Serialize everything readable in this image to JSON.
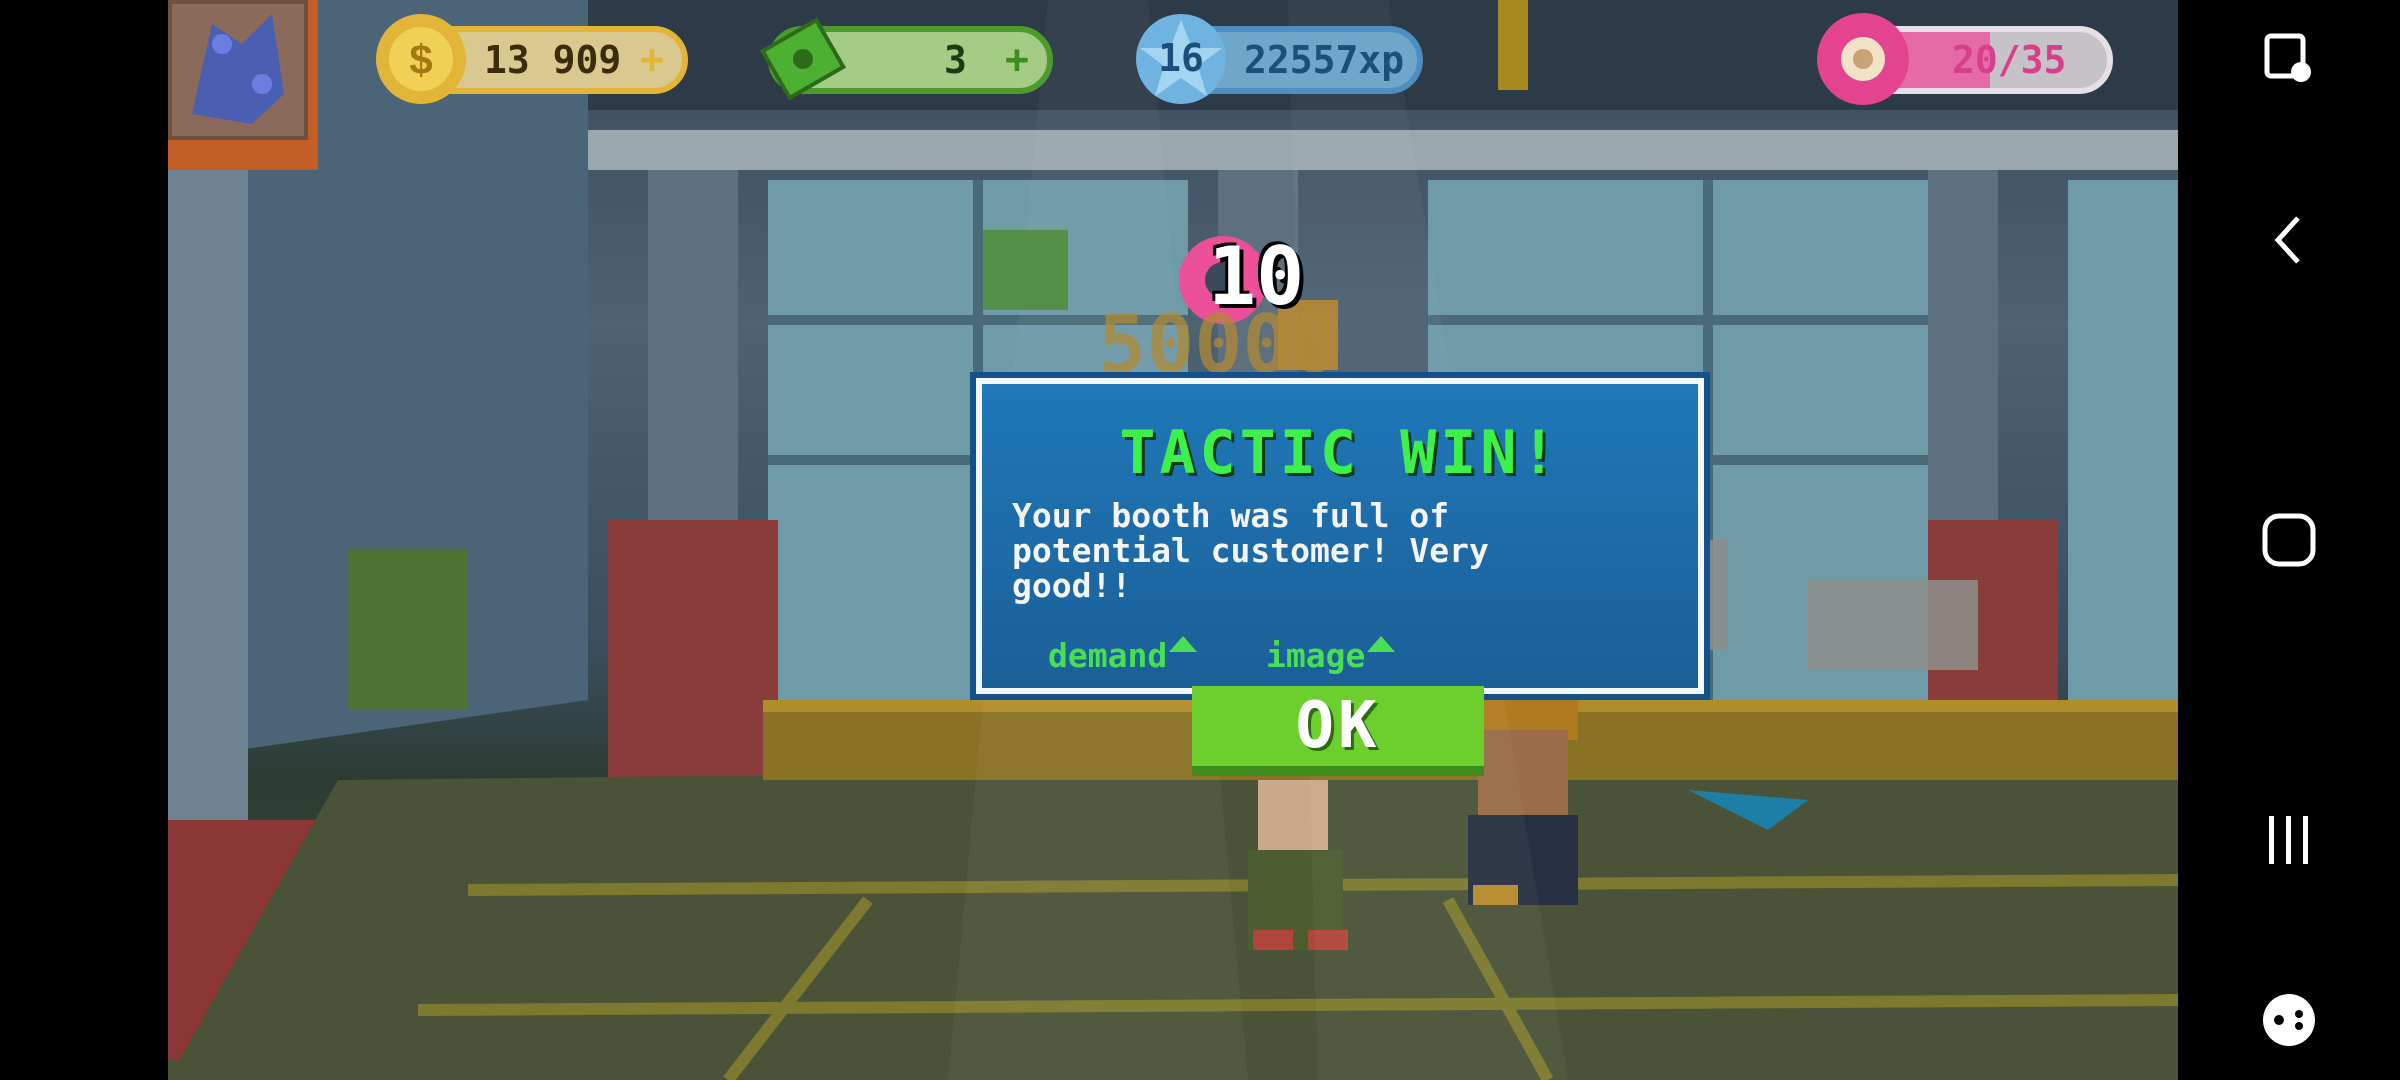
{
  "hud": {
    "coins": "13 909",
    "cash": "3",
    "level": "16",
    "xp": "22557xp",
    "donuts": "20/35",
    "donut_progress": 0.5714,
    "plus_symbol": "+"
  },
  "reward": {
    "amount": "10",
    "background_score": "50000"
  },
  "dialog": {
    "title": "TACTIC WIN!",
    "message": "Your booth was full of\npotential customer! Very\ngood!!",
    "stats": [
      {
        "label": "demand",
        "trend": "up"
      },
      {
        "label": "image",
        "trend": "up"
      }
    ],
    "ok_label": "OK"
  },
  "icons": {
    "avatar": "character-portrait-icon",
    "coin": "coin-icon",
    "cash": "cash-icon",
    "xp": "level-star-icon",
    "donut": "donut-icon",
    "nav": [
      "screen-capture-icon",
      "back-icon",
      "home-icon",
      "recent-apps-icon",
      "game-tools-icon"
    ]
  },
  "colors": {
    "title_green": "#3df04a",
    "dialog_blue": "#1f78b8",
    "ok_green": "#6dcf2d",
    "donut_pink": "#e46ba7"
  }
}
